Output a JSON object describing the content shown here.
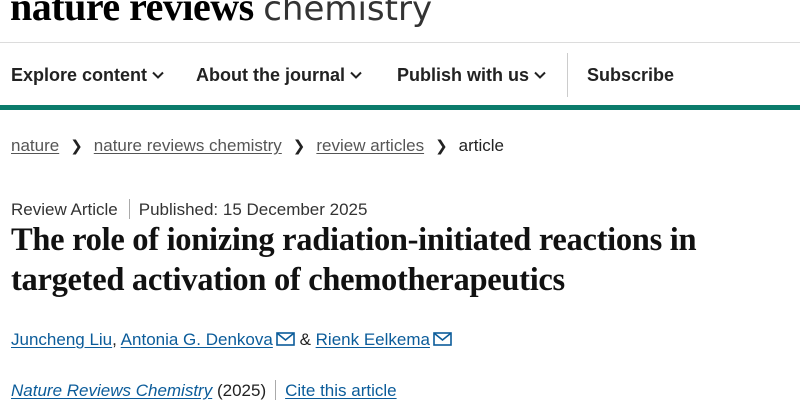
{
  "site": {
    "logo_bold": "nature reviews",
    "logo_light": "chemistry"
  },
  "nav": {
    "items": [
      {
        "label": "Explore content",
        "has_dropdown": true
      },
      {
        "label": "About the journal",
        "has_dropdown": true
      },
      {
        "label": "Publish with us",
        "has_dropdown": true
      },
      {
        "label": "Subscribe",
        "has_dropdown": false
      }
    ],
    "accent_color": "#0b7b6b"
  },
  "breadcrumb": {
    "items": [
      "nature",
      "nature reviews chemistry",
      "review articles"
    ],
    "current": "article"
  },
  "article": {
    "type": "Review Article",
    "published": "Published: 15 December 2025",
    "title": "The role of ionizing radiation-initiated reactions in targeted activation of chemotherapeutics",
    "authors": [
      {
        "name": "Juncheng Liu",
        "has_email": false
      },
      {
        "name": "Antonia G. Denkova",
        "has_email": true
      },
      {
        "name": "Rienk Eelkema",
        "has_email": true
      }
    ],
    "author_separators": [
      ",",
      "&"
    ],
    "journal": "Nature Reviews Chemistry",
    "year": "(2025)",
    "cite_label": "Cite this article",
    "link_color": "#0b5c9a"
  }
}
